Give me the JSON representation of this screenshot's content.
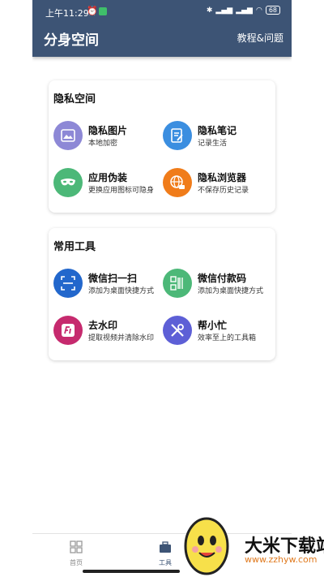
{
  "statusbar": {
    "time": "上午11:29",
    "battery": "68"
  },
  "header": {
    "title": "分身空间",
    "help_link": "教程&问题"
  },
  "privacy": {
    "title": "隐私空间",
    "items": [
      {
        "title": "隐私图片",
        "subtitle": "本地加密",
        "icon": "image-icon",
        "color": "#8d88d6"
      },
      {
        "title": "隐私笔记",
        "subtitle": "记录生活",
        "icon": "note-icon",
        "color": "#3b8ee0"
      },
      {
        "title": "应用伪装",
        "subtitle": "更换应用图标可隐身",
        "icon": "mask-icon",
        "color": "#4cb878"
      },
      {
        "title": "隐私浏览器",
        "subtitle": "不保存历史记录",
        "icon": "globe-lock-icon",
        "color": "#f07c1a"
      }
    ]
  },
  "tools": {
    "title": "常用工具",
    "items": [
      {
        "title": "微信扫一扫",
        "subtitle": "添加为桌面快捷方式",
        "icon": "scan-icon",
        "color": "#2267cc"
      },
      {
        "title": "微信付款码",
        "subtitle": "添加为桌面快捷方式",
        "icon": "payment-code-icon",
        "color": "#4cb878"
      },
      {
        "title": "去水印",
        "subtitle": "提取视频并清除水印",
        "icon": "watermark-remove-icon",
        "color": "#c62a6e"
      },
      {
        "title": "帮小忙",
        "subtitle": "效率至上的工具箱",
        "icon": "tools-icon",
        "color": "#5d5fd6"
      }
    ]
  },
  "bottom_nav": {
    "home": "首页",
    "tools": "工具"
  },
  "watermark": {
    "text": "大米下载站",
    "url": "www.zzhyw.com"
  }
}
